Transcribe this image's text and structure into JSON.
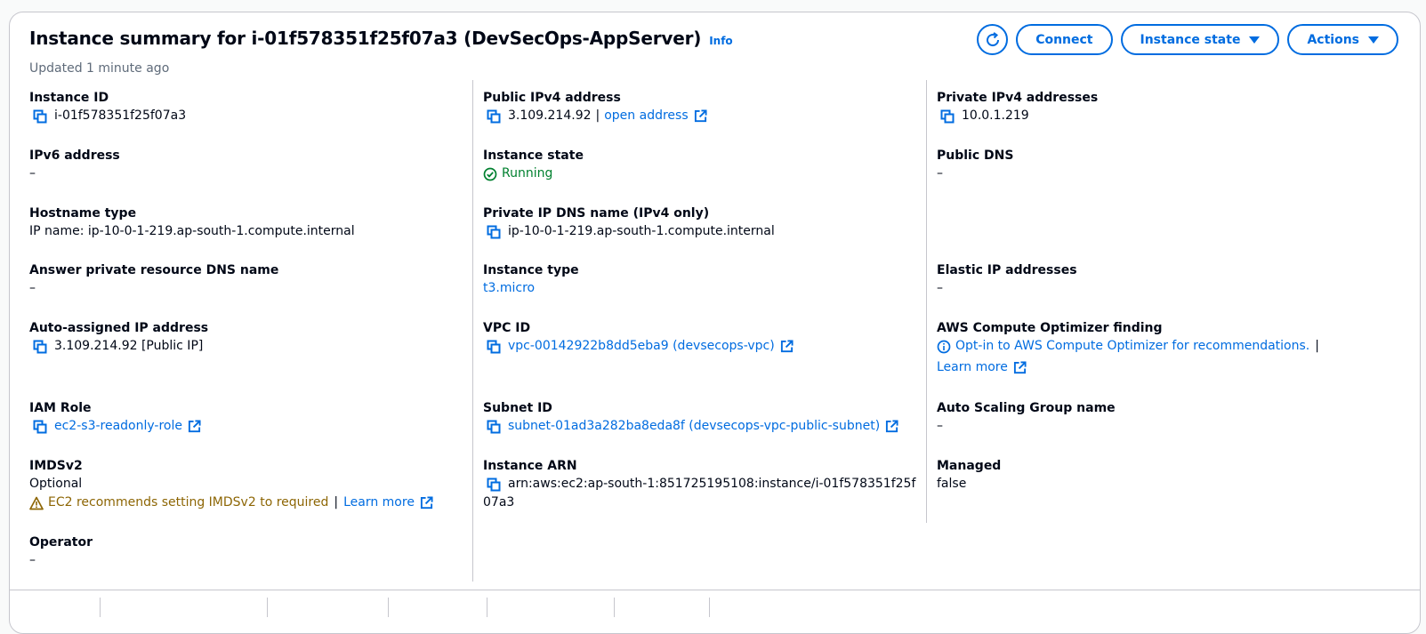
{
  "header": {
    "title": "Instance summary for i-01f578351f25f07a3 (DevSecOps-AppServer)",
    "info": "Info",
    "updated": "Updated 1 minute ago"
  },
  "buttons": {
    "connect": "Connect",
    "instance_state": "Instance state",
    "actions": "Actions"
  },
  "fields": {
    "instance_id": {
      "label": "Instance ID",
      "value": "i-01f578351f25f07a3"
    },
    "ipv6": {
      "label": "IPv6 address",
      "value": "–"
    },
    "hostname_type": {
      "label": "Hostname type",
      "value": "IP name: ip-10-0-1-219.ap-south-1.compute.internal"
    },
    "answer_dns": {
      "label": "Answer private resource DNS name",
      "value": "–"
    },
    "auto_ip": {
      "label": "Auto-assigned IP address",
      "value": "3.109.214.92 [Public IP]"
    },
    "iam_role": {
      "label": "IAM Role",
      "value": "ec2-s3-readonly-role"
    },
    "imdsv2": {
      "label": "IMDSv2",
      "value": "Optional",
      "warning": "EC2 recommends setting IMDSv2 to required",
      "sep": "|",
      "learn_more": "Learn more"
    },
    "operator": {
      "label": "Operator",
      "value": "–"
    },
    "public_ipv4": {
      "label": "Public IPv4 address",
      "value": "3.109.214.92",
      "sep": "|",
      "link": "open address"
    },
    "instance_state": {
      "label": "Instance state",
      "value": "Running"
    },
    "private_dns": {
      "label": "Private IP DNS name (IPv4 only)",
      "value": "ip-10-0-1-219.ap-south-1.compute.internal"
    },
    "instance_type": {
      "label": "Instance type",
      "value": "t3.micro"
    },
    "vpc_id": {
      "label": "VPC ID",
      "value": "vpc-00142922b8dd5eba9 (devsecops-vpc)"
    },
    "subnet_id": {
      "label": "Subnet ID",
      "value": "subnet-01ad3a282ba8eda8f (devsecops-vpc-public-subnet)"
    },
    "instance_arn": {
      "label": "Instance ARN",
      "line1": "arn:aws:ec2:ap-south-1:851725195108:instance/i-01f578351f25f",
      "line2": "07a3"
    },
    "private_ipv4": {
      "label": "Private IPv4 addresses",
      "value": "10.0.1.219"
    },
    "public_dns": {
      "label": "Public DNS",
      "value": "–"
    },
    "elastic_ip": {
      "label": "Elastic IP addresses",
      "value": "–"
    },
    "optimizer": {
      "label": "AWS Compute Optimizer finding",
      "value": "Opt-in to AWS Compute Optimizer for recommendations.",
      "sep": "|",
      "learn_more": "Learn more"
    },
    "asg": {
      "label": "Auto Scaling Group name",
      "value": "–"
    },
    "managed": {
      "label": "Managed",
      "value": "false"
    }
  },
  "colors": {
    "link": "#006ce0",
    "success": "#00802f",
    "warning": "#8d6605",
    "border": "#c6c6cd",
    "muted": "#5f6b7a"
  },
  "icons": [
    "refresh-icon",
    "caret-down-icon",
    "copy-icon",
    "external-link-icon",
    "check-circle-icon",
    "warning-icon",
    "info-circle-icon"
  ]
}
